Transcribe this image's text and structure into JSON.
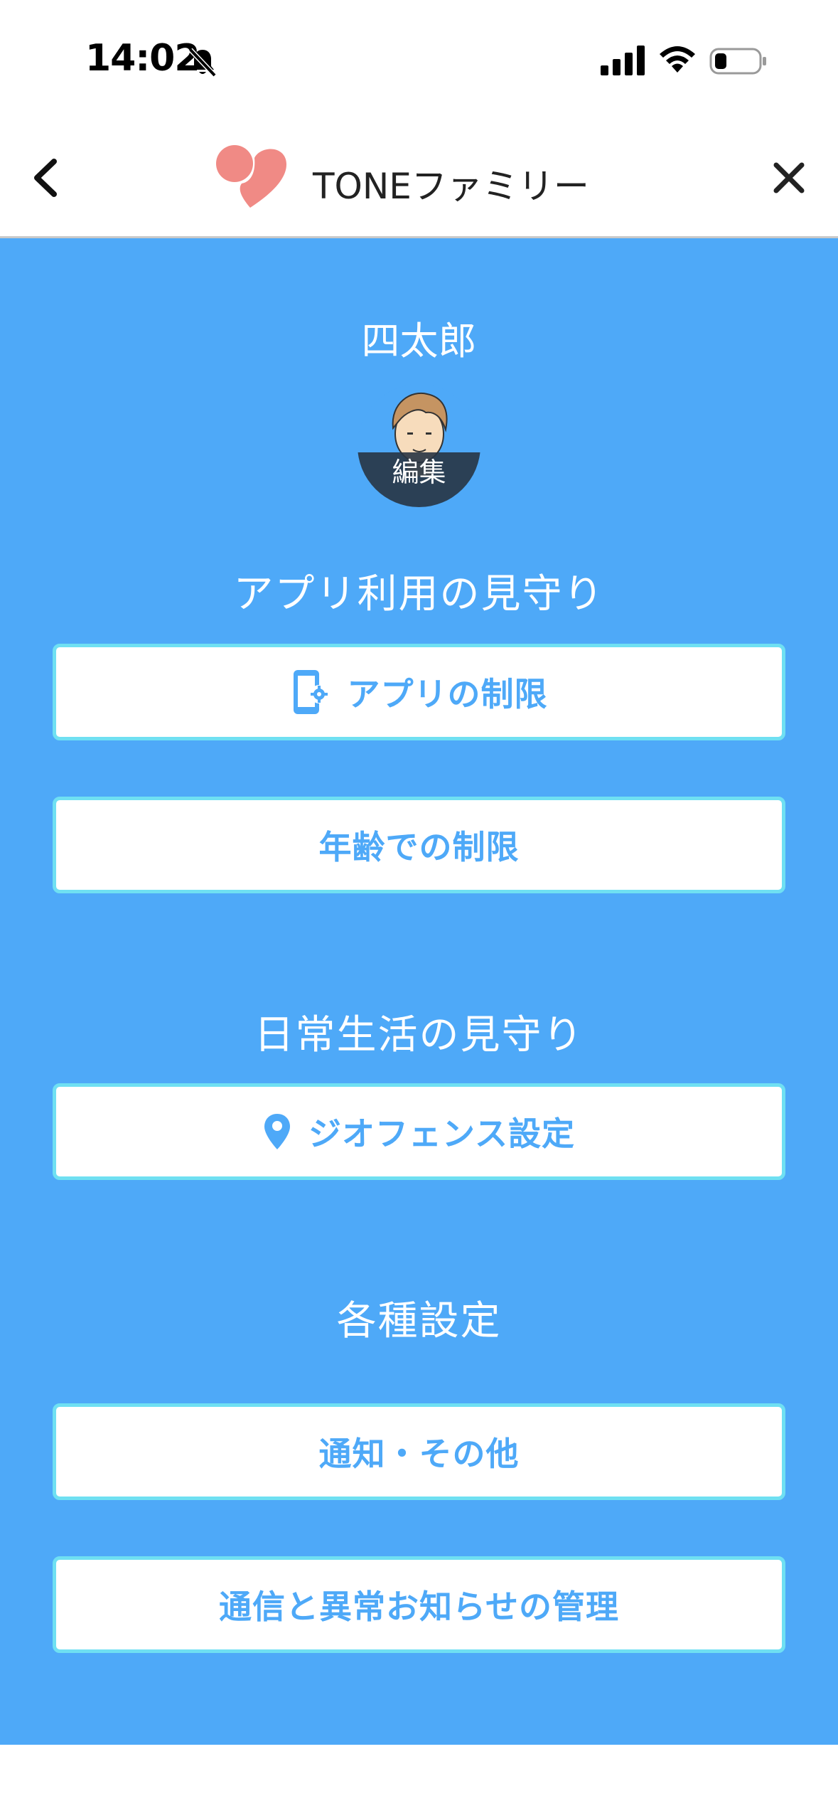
{
  "status_bar": {
    "time": "14:02",
    "icons": [
      "bell-slash-icon",
      "cellular-signal-icon",
      "wifi-icon",
      "battery-icon"
    ]
  },
  "header": {
    "title": "TONEファミリー",
    "back_icon": "chevron-left-icon",
    "close_icon": "close-icon",
    "logo_icon": "tone-heart-logo"
  },
  "profile": {
    "name": "四太郎",
    "edit_label": "編集"
  },
  "sections": {
    "app_usage": {
      "title": "アプリ利用の見守り",
      "app_limit_label": "アプリの制限",
      "app_limit_icon": "phone-gear-icon",
      "age_limit_label": "年齢での制限"
    },
    "daily_life": {
      "title": "日常生活の見守り",
      "geofence_label": "ジオフェンス設定",
      "geofence_icon": "map-pin-icon"
    },
    "settings": {
      "title": "各種設定",
      "notifications_label": "通知・その他",
      "connection_label": "通信と異常お知らせの管理"
    }
  },
  "colors": {
    "panel_blue": "#4ea9f8",
    "button_border": "#6fe0f2",
    "button_text": "#4ea9f8",
    "logo_pink": "#f08a85"
  }
}
